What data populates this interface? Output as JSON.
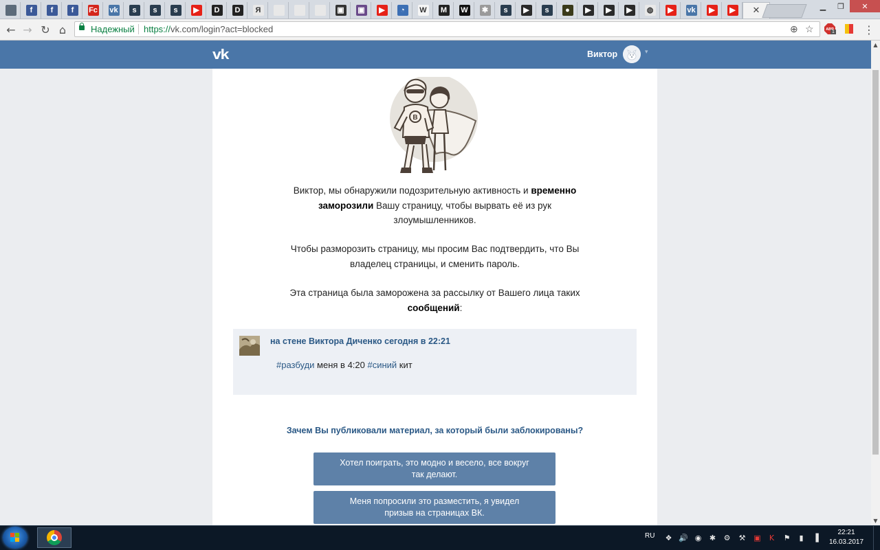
{
  "browser": {
    "tabs": [
      {
        "icon": "generic-favicon-icon",
        "color": "#5c6b7a",
        "glyph": "",
        "x": 0
      },
      {
        "icon": "facebook-favicon-icon",
        "color": "#3b5998",
        "glyph": "f"
      },
      {
        "icon": "facebook-favicon-icon",
        "color": "#3b5998",
        "glyph": "f"
      },
      {
        "icon": "facebook-favicon-icon",
        "color": "#3b5998",
        "glyph": "f"
      },
      {
        "icon": "fc-favicon-icon",
        "color": "#d4261c",
        "glyph": "Fc"
      },
      {
        "icon": "vk-favicon-icon",
        "color": "#4a76a8",
        "glyph": "vk"
      },
      {
        "icon": "s-favicon-icon",
        "color": "#2a3d4f",
        "glyph": "s"
      },
      {
        "icon": "s-favicon-icon",
        "color": "#2a3d4f",
        "glyph": "s"
      },
      {
        "icon": "s-favicon-icon",
        "color": "#2a3d4f",
        "glyph": "s"
      },
      {
        "icon": "youtube-favicon-icon",
        "color": "#e62117",
        "glyph": "▶"
      },
      {
        "icon": "d-favicon-icon",
        "color": "#222222",
        "glyph": "D"
      },
      {
        "icon": "d-favicon-icon",
        "color": "#222222",
        "glyph": "D"
      },
      {
        "icon": "yandex-favicon-icon",
        "color": "#e8e8e8",
        "glyph": "Я"
      },
      {
        "icon": "document-favicon-icon",
        "color": "#e8e8e8",
        "glyph": ""
      },
      {
        "icon": "document-favicon-icon",
        "color": "#e8e8e8",
        "glyph": ""
      },
      {
        "icon": "document-favicon-icon",
        "color": "#e8e8e8",
        "glyph": ""
      },
      {
        "icon": "image-favicon-icon",
        "color": "#333333",
        "glyph": "▣"
      },
      {
        "icon": "image-favicon-icon",
        "color": "#6a4a8a",
        "glyph": "▣"
      },
      {
        "icon": "youtube-favicon-icon",
        "color": "#e62117",
        "glyph": "▶"
      },
      {
        "icon": "compass-favicon-icon",
        "color": "#3c6fb4",
        "glyph": "◔"
      },
      {
        "icon": "wikipedia-favicon-icon",
        "color": "#f5f5f5",
        "glyph": "W"
      },
      {
        "icon": "m-favicon-icon",
        "color": "#222222",
        "glyph": "M"
      },
      {
        "icon": "w-favicon-icon",
        "color": "#111111",
        "glyph": "W"
      },
      {
        "icon": "bug-favicon-icon",
        "color": "#9a9a9a",
        "glyph": "✱"
      },
      {
        "icon": "s-favicon-icon",
        "color": "#2a3d4f",
        "glyph": "s"
      },
      {
        "icon": "play-favicon-icon",
        "color": "#2a2a2a",
        "glyph": "▶"
      },
      {
        "icon": "s-favicon-icon",
        "color": "#2a3d4f",
        "glyph": "s"
      },
      {
        "icon": "image-favicon-icon",
        "color": "#3a3a1a",
        "glyph": "●"
      },
      {
        "icon": "play-favicon-icon",
        "color": "#2a2a2a",
        "glyph": "▶"
      },
      {
        "icon": "play-favicon-icon",
        "color": "#2a2a2a",
        "glyph": "▶"
      },
      {
        "icon": "play-favicon-icon",
        "color": "#2a2a2a",
        "glyph": "▶"
      },
      {
        "icon": "mouse-favicon-icon",
        "color": "#e8e8e8",
        "glyph": "◍"
      },
      {
        "icon": "youtube-favicon-icon",
        "color": "#e62117",
        "glyph": "▶"
      },
      {
        "icon": "vk-favicon-icon",
        "color": "#4a76a8",
        "glyph": "vk"
      },
      {
        "icon": "youtube-favicon-icon",
        "color": "#e62117",
        "glyph": "▶"
      },
      {
        "icon": "youtube-favicon-icon",
        "color": "#e62117",
        "glyph": "▶"
      }
    ],
    "active_tab_close": "✕",
    "window_controls": {
      "minimize": "▁",
      "restore": "❐",
      "close": "✕"
    },
    "nav": {
      "back": "←",
      "forward": "→",
      "reload": "↻",
      "home": "⌂"
    },
    "address": {
      "secure_label": "Надежный",
      "url_prefix": "https://",
      "url_rest": "vk.com/login?act=blocked"
    },
    "adblock_badge": "1"
  },
  "vk": {
    "logo": "vk",
    "user_name": "Виктор",
    "dropdown_arrow": "▾"
  },
  "page": {
    "paragraph1": {
      "parts": [
        {
          "text": "Виктор, мы обнаружили подозрительную активность и ",
          "bold": false
        },
        {
          "text": "временно",
          "bold": true
        },
        {
          "br": true
        },
        {
          "text": "заморозили",
          "bold": true
        },
        {
          "text": " Вашу страницу, чтобы вырвать её из рук",
          "bold": false
        },
        {
          "br": true
        },
        {
          "text": "злоумышленников.",
          "bold": false
        }
      ]
    },
    "paragraph2": {
      "parts": [
        {
          "text": "Чтобы разморозить страницу, мы просим Вас подтвердить, что Вы",
          "bold": false
        },
        {
          "br": true
        },
        {
          "text": "владелец страницы, и сменить пароль.",
          "bold": false
        }
      ]
    },
    "paragraph3": {
      "parts": [
        {
          "text": "Эта страница была заморожена за рассылку от Вашего лица таких",
          "bold": false
        },
        {
          "br": true
        },
        {
          "text": "сообщений",
          "bold": true
        },
        {
          "text": ":",
          "bold": false
        }
      ]
    },
    "post": {
      "author_line": "на стене Виктора Диченко сегодня в 22:21",
      "text_parts": [
        {
          "text": "#разбуди",
          "hashtag": true
        },
        {
          "text": " меня в 4:20 ",
          "hashtag": false
        },
        {
          "text": "#синий",
          "hashtag": true
        },
        {
          "text": " кит",
          "hashtag": false
        }
      ]
    },
    "question": "Зачем Вы публиковали материал, за который были заблокированы?",
    "answers": [
      "Хотел поиграть, это модно и весело, все вокруг так делают.",
      "Меня попросили это разместить, я увидел призыв на страницах ВК."
    ]
  },
  "taskbar": {
    "language": "RU",
    "time": "22:21",
    "date": "16.03.2017"
  },
  "colors": {
    "vk_blue": "#4a76a8",
    "link_blue": "#2a5885",
    "button_blue": "#5e81a8",
    "post_bg": "#edf0f5",
    "secure_green": "#0b8043"
  }
}
